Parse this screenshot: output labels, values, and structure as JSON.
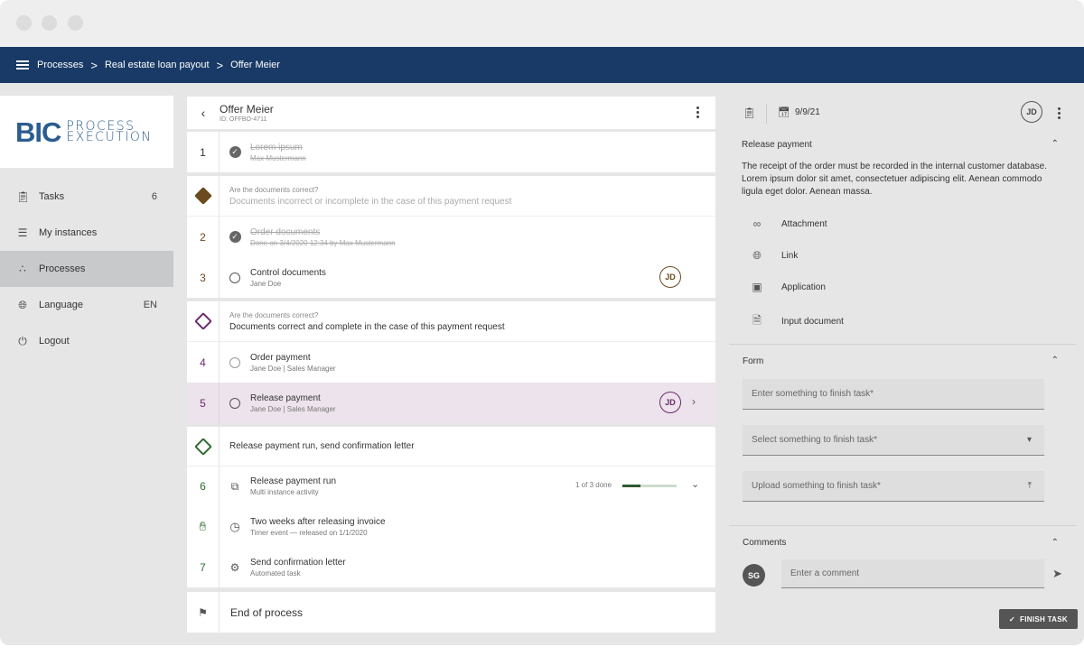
{
  "breadcrumb": {
    "items": [
      "Processes",
      "Real estate loan payout",
      "Offer Meier"
    ],
    "separator": ">"
  },
  "logo": {
    "main": "BIC",
    "line1": "PROCESS",
    "line2": "EXECUTION"
  },
  "sidebar": {
    "items": [
      {
        "label": "Tasks",
        "value": "6",
        "icon": "clipboard-icon"
      },
      {
        "label": "My instances",
        "value": "",
        "icon": "list-icon"
      },
      {
        "label": "Processes",
        "value": "",
        "icon": "hierarchy-icon",
        "active": true
      },
      {
        "label": "Language",
        "value": "EN",
        "icon": "globe-icon"
      },
      {
        "label": "Logout",
        "value": "",
        "icon": "power-icon"
      }
    ]
  },
  "instance": {
    "title": "Offer Meier",
    "id": "ID: OFFBO-4711"
  },
  "steps": {
    "s1": {
      "num": "1",
      "main": "Lorem ipsum",
      "sub": "Max Mustermann"
    },
    "g1": {
      "question": "Are the documents correct?",
      "answer": "Documents incorrect or incomplete in the case of this payment request"
    },
    "s2": {
      "num": "2",
      "main": "Order documents",
      "sub": "Done on 3/4/2020 12:34 by Max Mustermann"
    },
    "s3": {
      "num": "3",
      "main": "Control documents",
      "sub": "Jane Doe",
      "avatar": "JD"
    },
    "g2": {
      "question": "Are the documents correct?",
      "answer": "Documents correct and complete in the case of this payment request"
    },
    "s4": {
      "num": "4",
      "main": "Order payment",
      "sub": "Jane Doe | Sales Manager"
    },
    "s5": {
      "num": "5",
      "main": "Release payment",
      "sub": "Jane Doe | Sales Manager",
      "avatar": "JD"
    },
    "g3": {
      "answer": "Release payment run, send confirmation letter"
    },
    "s6": {
      "num": "6",
      "main": "Release payment run",
      "sub": "Multi instance activity",
      "progress": "1 of 3 done",
      "progress_value": 0.33
    },
    "t1": {
      "main": "Two weeks after releasing invoice",
      "sub": "Timer event — released on 1/1/2020"
    },
    "s7": {
      "num": "7",
      "main": "Send confirmation letter",
      "sub": "Automated task"
    },
    "end": {
      "label": "End of process"
    }
  },
  "detail": {
    "date": "9/9/21",
    "avatar": "JD",
    "section_title": "Release payment",
    "description": "The receipt of the order must be recorded in the internal customer database. Lorem ipsum dolor sit amet, consectetuer adipiscing elit. Aenean commodo ligula eget dolor. Aenean massa.",
    "resources": [
      {
        "label": "Attachment",
        "icon": "attachment-icon"
      },
      {
        "label": "Link",
        "icon": "globe-icon"
      },
      {
        "label": "Application",
        "icon": "apps-icon"
      },
      {
        "label": "Input document",
        "icon": "document-icon"
      }
    ]
  },
  "form": {
    "title": "Form",
    "text_placeholder": "Enter something to finish task*",
    "select_placeholder": "Select something to finish task*",
    "upload_placeholder": "Upload something to finish task*"
  },
  "comments": {
    "title": "Comments",
    "avatar": "SG",
    "placeholder": "Enter a comment"
  },
  "finish_label": "FINISH TASK",
  "colors": {
    "appbar": "#193a66",
    "brand": "#2c5d8f",
    "gateway_purple": "#6b2a6b",
    "gateway_brown": "#6b4a1f",
    "gateway_green": "#2f6b2f",
    "selected_row": "#ede3ec"
  }
}
